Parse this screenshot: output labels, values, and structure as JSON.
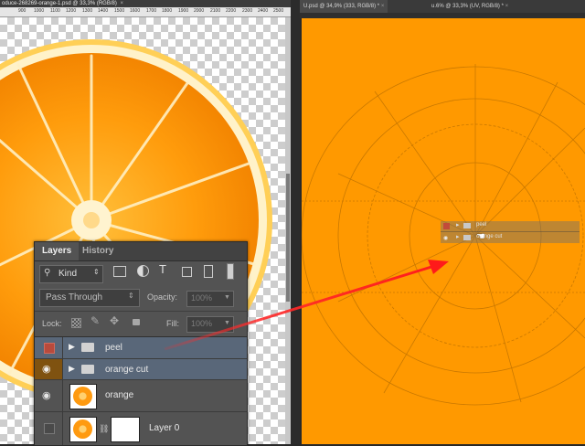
{
  "left_document": {
    "tab_title": "oduce-268269-orange-1.psd @ 33,3% (RGB/8)",
    "ruler_ticks": [
      "900",
      "1000",
      "1100",
      "1200",
      "1300",
      "1400",
      "1500",
      "1600",
      "1700",
      "1800",
      "1900",
      "2000",
      "2100",
      "2200",
      "2300",
      "2400",
      "2500"
    ]
  },
  "right_document": {
    "tabs": [
      {
        "label": "U.psd @ 34,9% (333, RGB/8) *"
      },
      {
        "label": "u.6% @ 33,3% (UV, RGB/8) *"
      }
    ],
    "mini_layers": [
      "peel",
      "orange cut"
    ]
  },
  "layers_panel": {
    "tabs": [
      "Layers",
      "History"
    ],
    "filter": {
      "selected": "Kind"
    },
    "blend_mode": "Pass Through",
    "opacity_label": "Opacity:",
    "opacity_value": "100%",
    "lock_label": "Lock:",
    "fill_label": "Fill:",
    "fill_value": "100%",
    "layers": [
      {
        "name": "peel",
        "type": "group",
        "visibility": "red-swatch",
        "selected": true
      },
      {
        "name": "orange cut",
        "type": "group",
        "visibility": "eye",
        "selected": true
      },
      {
        "name": "orange",
        "type": "image",
        "visibility": "eye",
        "selected": false
      },
      {
        "name": "Layer 0",
        "type": "image-with-mask",
        "visibility": "hidden",
        "selected": false
      }
    ]
  },
  "colors": {
    "orange_canvas": "#ff9900",
    "panel_bg": "#535353",
    "selected_row": "#596779",
    "annotation_arrow": "#ff2020"
  }
}
